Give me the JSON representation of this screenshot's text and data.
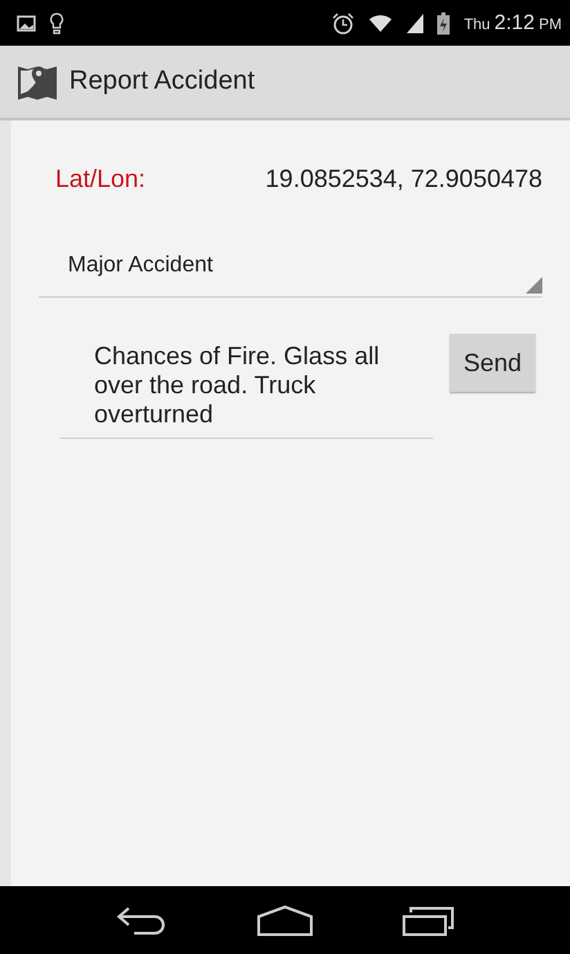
{
  "status_bar": {
    "day": "Thu",
    "time": "2:12",
    "ampm": "PM"
  },
  "action_bar": {
    "title": "Report Accident"
  },
  "location": {
    "label": "Lat/Lon:",
    "value": "19.0852534, 72.9050478"
  },
  "severity_dropdown": {
    "value": "Major Accident"
  },
  "message": {
    "value": "Chances of Fire. Glass all over the road. Truck overturned"
  },
  "send_button": {
    "label": "Send"
  }
}
